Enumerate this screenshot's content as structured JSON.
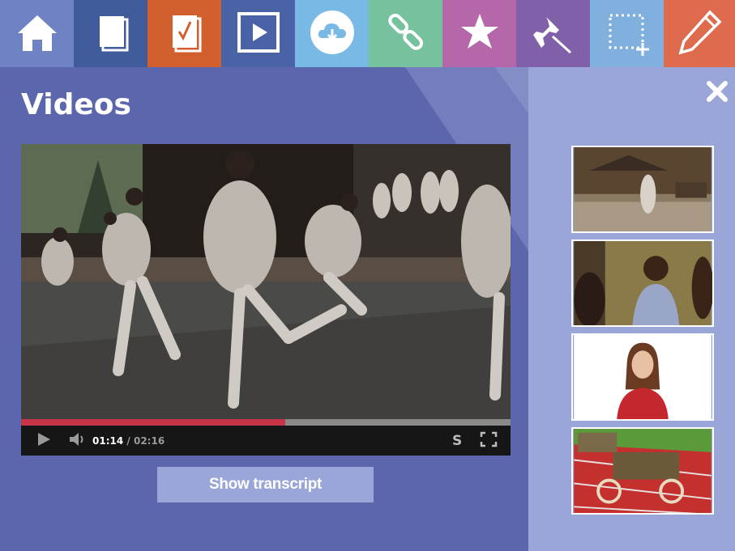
{
  "toolbar": {
    "items": [
      {
        "icon": "home-icon",
        "color": "#6e82c4"
      },
      {
        "icon": "pages-icon",
        "color": "#3f5b9a"
      },
      {
        "icon": "checklist-icon",
        "color": "#d2602e"
      },
      {
        "icon": "play-icon",
        "color": "#4a63a6"
      },
      {
        "icon": "cloud-download-icon",
        "color": "#79b9e5"
      },
      {
        "icon": "link-icon",
        "color": "#76c29f"
      },
      {
        "icon": "star-icon",
        "color": "#b567a9"
      },
      {
        "icon": "pin-icon",
        "color": "#8060a8"
      },
      {
        "icon": "select-area-icon",
        "color": "#80b0de"
      },
      {
        "icon": "pencil-icon",
        "color": "#df6b4f"
      }
    ]
  },
  "panel": {
    "title": "Videos",
    "close_icon": "close-icon"
  },
  "player": {
    "current_time": "01:14",
    "separator": "/",
    "duration": "02:16",
    "progress": 0.54,
    "subtitles_label": "S",
    "progress_color": "#c63447"
  },
  "transcript_button": {
    "label": "Show transcript"
  },
  "playlist": {
    "thumbnails": [
      {
        "icon": "temple-thumbnail"
      },
      {
        "icon": "classroom-thumbnail"
      },
      {
        "icon": "presenter-thumbnail"
      },
      {
        "icon": "cart-thumbnail"
      }
    ]
  },
  "colors": {
    "main_bg": "#5c66ad",
    "sidebar_bg": "#9aa6d8",
    "button_bg": "#9aa6d8"
  }
}
